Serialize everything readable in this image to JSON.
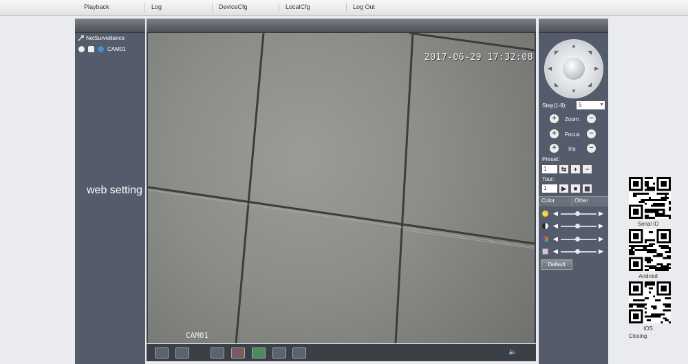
{
  "nav": {
    "items": [
      "Playback",
      "Log",
      "DeviceCfg",
      "LocalCfg",
      "Log Out"
    ]
  },
  "tree": {
    "root": "NetSurveillance",
    "camera": "CAM01"
  },
  "video": {
    "timestamp": "2017-06-29 17:32:08",
    "cam_label": "CAM01"
  },
  "ptz": {
    "step_label": "Step(1-8):",
    "step_value": "5",
    "zoom_label": "Zoom",
    "focus_label": "Focus",
    "iris_label": "Iris",
    "preset_label": "Preset:",
    "preset_value": "1",
    "tour_label": "Tour:",
    "tour_value": "1"
  },
  "color": {
    "tab_color": "Color",
    "tab_other": "Other",
    "default_label": "Default",
    "levels": [
      0.48,
      0.48,
      0.48,
      0.48
    ]
  },
  "overlay": {
    "web_setting": "web setting"
  },
  "qr": {
    "serial": "Serial ID",
    "android": "Android",
    "ios": "IOS",
    "closing": "Closing"
  },
  "colors": {
    "panel": "#545c6c",
    "frame": "#3b3f46",
    "accent": "#3d8fd6"
  }
}
